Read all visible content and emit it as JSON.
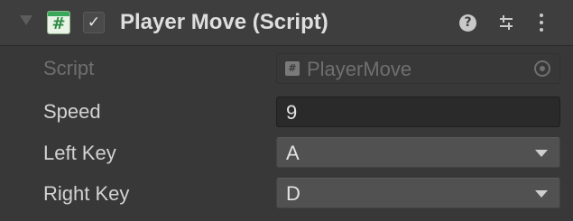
{
  "component": {
    "title": "Player Move (Script)",
    "enabled": true,
    "icons": {
      "foldout": "foldout-arrow-icon",
      "script": "cs-script-icon",
      "help": "help-icon",
      "presets": "presets-icon",
      "menu": "kebab-menu-icon"
    },
    "help_glyph": "?"
  },
  "fields": {
    "script": {
      "label": "Script",
      "value": "PlayerMove"
    },
    "speed": {
      "label": "Speed",
      "value": "9"
    },
    "left_key": {
      "label": "Left Key",
      "value": "A"
    },
    "right_key": {
      "label": "Right Key",
      "value": "D"
    }
  },
  "colors": {
    "background": "#383838",
    "header": "#3e3e3e",
    "script_icon_green": "#3aa85b",
    "disabled_text": "#6f6f6f",
    "text": "#d2d2d2"
  }
}
